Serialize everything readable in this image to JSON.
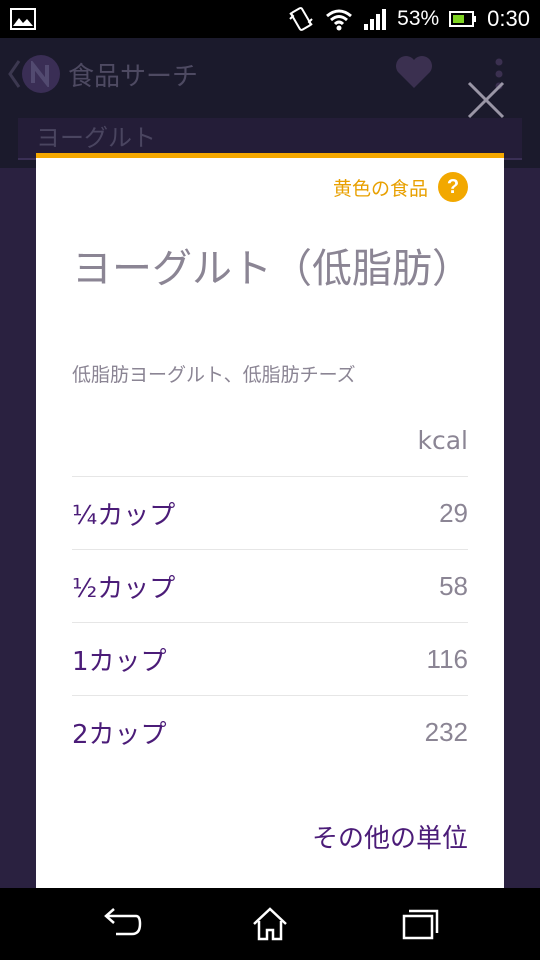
{
  "status": {
    "battery_percent": "53%",
    "clock": "0:30"
  },
  "appbar": {
    "title": "食品サーチ"
  },
  "search": {
    "query": "ヨーグルト"
  },
  "dialog": {
    "category_label": "黄色の食品",
    "help_symbol": "?",
    "title": "ヨーグルト（低脂肪）",
    "subtitle": "低脂肪ヨーグルト、低脂肪チーズ",
    "unit_header": "kcal",
    "rows": [
      {
        "label": "¼カップ",
        "value": "29"
      },
      {
        "label": "½カップ",
        "value": "58"
      },
      {
        "label": "1カップ",
        "value": "116"
      },
      {
        "label": "2カップ",
        "value": "232"
      }
    ],
    "more_units_label": "その他の単位"
  },
  "colors": {
    "accent_yellow": "#f4a800",
    "primary_purple": "#4b1c78",
    "text_gray": "#8b8594"
  },
  "icons": {
    "status": [
      "gallery-icon",
      "vibrate-icon",
      "wifi-icon",
      "signal-icon",
      "battery-icon"
    ],
    "nav": [
      "back-icon",
      "home-icon",
      "recents-icon"
    ]
  }
}
